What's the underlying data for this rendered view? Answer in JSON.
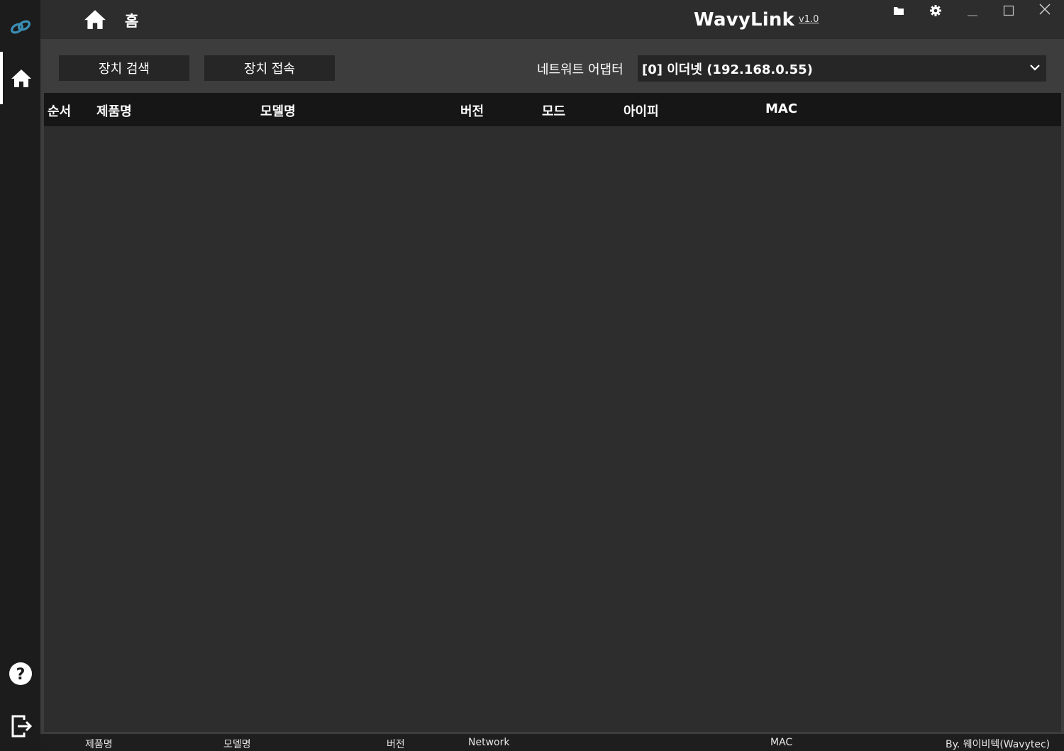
{
  "titlebar": {
    "page_title": "홈",
    "app_title": "WavyLink",
    "version": "v1.0",
    "icons": [
      "folder-icon",
      "gear-icon",
      "minimize-icon",
      "maximize-icon",
      "close-icon"
    ]
  },
  "sidebar": {
    "icons": [
      "link-logo-icon",
      "home-icon",
      "help-icon",
      "logout-icon"
    ],
    "active_item": "home",
    "logo_color": "#3a8fb5"
  },
  "toolbar": {
    "search_label": "장치 검색",
    "connect_label": "장치 접속",
    "adapter_label": "네트워트 어댑터",
    "adapter_value": "[0] 이더넷 (192.168.0.55)"
  },
  "table": {
    "columns": [
      "순서",
      "제품명",
      "모델명",
      "버전",
      "모드",
      "아이피",
      "MAC"
    ],
    "rows": []
  },
  "statusbar": {
    "product": "제품명",
    "model": "모델명",
    "version": "버전",
    "network": "Network",
    "mac": "MAC",
    "credit": "By. 웨이비텍(Wavytec)"
  },
  "colors": {
    "sidebar_bg": "#1c1c1c",
    "titlebar_bg": "#2d2d2d",
    "main_bg": "#3d3d3d",
    "table_bg": "#2d2d2d",
    "header_bg": "#161616"
  }
}
